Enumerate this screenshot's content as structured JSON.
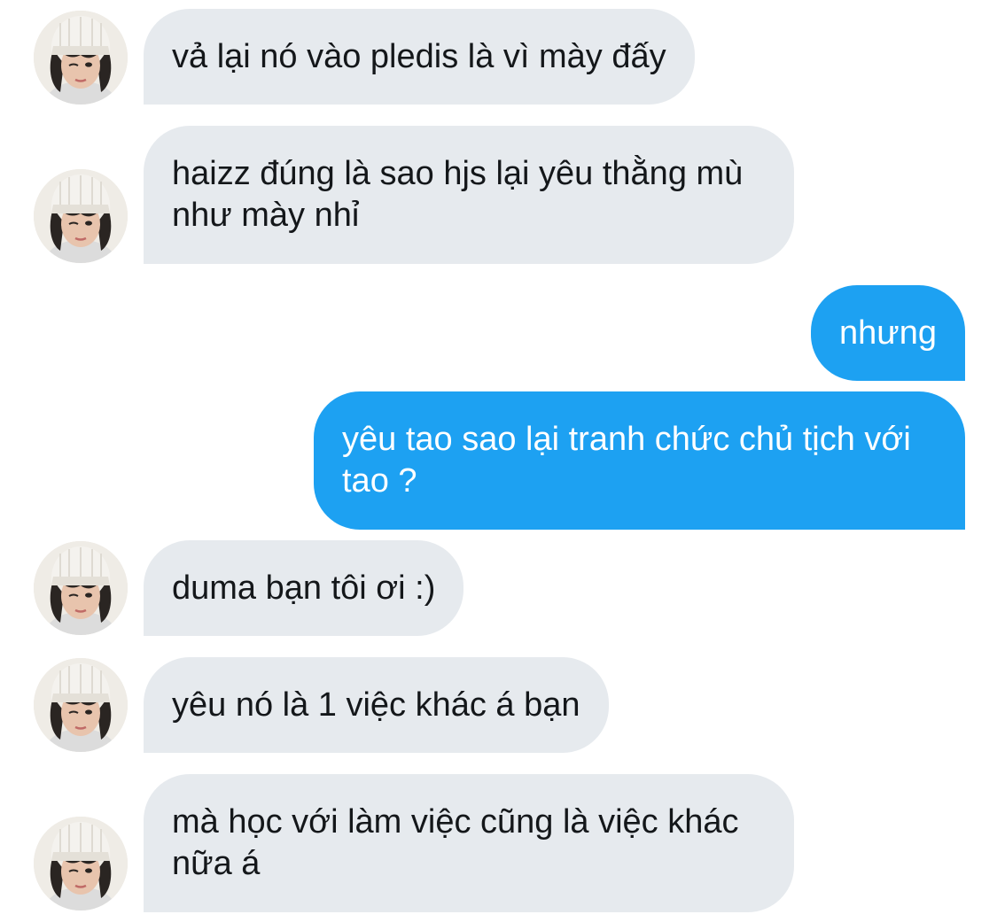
{
  "conversation": {
    "messages": [
      {
        "sender": "them",
        "text": "vả lại nó vào pledis là vì mày đấy"
      },
      {
        "sender": "them",
        "text": "haizz đúng là sao hjs lại yêu thằng mù như mày nhỉ"
      },
      {
        "sender": "me",
        "text": "nhưng"
      },
      {
        "sender": "me",
        "text": "yêu tao sao lại tranh chức chủ tịch với tao ?"
      },
      {
        "sender": "them",
        "text": "duma bạn tôi ơi :)"
      },
      {
        "sender": "them",
        "text": "yêu nó là 1 việc khác á bạn"
      },
      {
        "sender": "them",
        "text": "mà học với làm việc cũng là việc khác nữa á"
      }
    ]
  },
  "colors": {
    "incoming_bubble": "#e6eaee",
    "outgoing_bubble": "#1da1f2",
    "incoming_text": "#14171a",
    "outgoing_text": "#ffffff"
  }
}
